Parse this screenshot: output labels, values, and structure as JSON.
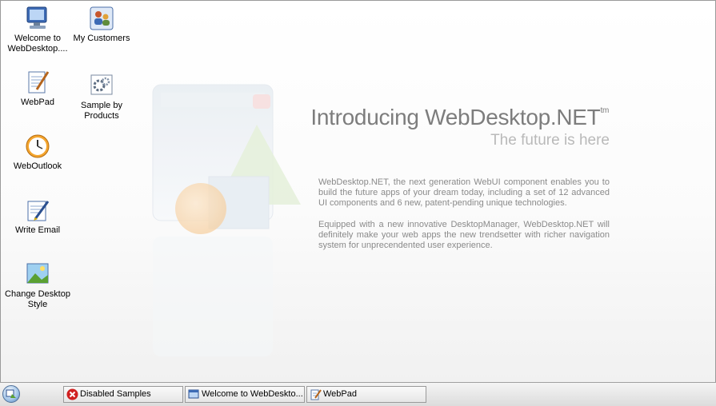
{
  "desktop": {
    "icons": [
      {
        "label": "Welcome to WebDesktop....",
        "icon": "computer-icon"
      },
      {
        "label": "My Customers",
        "icon": "customers-icon"
      },
      {
        "label": "WebPad",
        "icon": "notepad-icon"
      },
      {
        "label": "Sample by Products",
        "icon": "gears-icon"
      },
      {
        "label": "WebOutlook",
        "icon": "clock-icon"
      },
      {
        "label": "Write Email",
        "icon": "email-icon"
      },
      {
        "label": "Change Desktop Style",
        "icon": "picture-icon"
      }
    ]
  },
  "hero": {
    "title": "Introducing WebDesktop.NET",
    "tm": "tm",
    "subtitle": "The future is here",
    "para1": "WebDesktop.NET, the next generation WebUI component enables you to build the future apps of your dream today, including a set of 12 advanced UI components and 6 new, patent-pending unique technologies.",
    "para2": "Equipped with a new innovative DesktopManager, WebDesktop.NET will definitely make your web apps the new trendsetter with richer navigation system for unprecendented user experience."
  },
  "taskbar": {
    "tasks": [
      {
        "label": "Disabled Samples",
        "icon": "error-icon"
      },
      {
        "label": "Welcome to WebDeskto...",
        "icon": "window-icon"
      },
      {
        "label": "WebPad",
        "icon": "notepad-icon"
      }
    ]
  },
  "colors": {
    "title": "#7d7d7d",
    "subtitle": "#b9b9b9",
    "body_text": "#8a8a8a",
    "error": "#d02020"
  }
}
